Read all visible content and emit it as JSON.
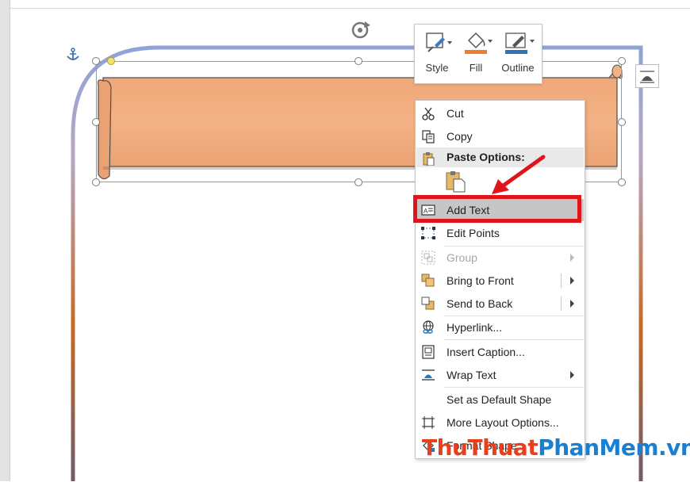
{
  "mini_toolbar": {
    "style_label": "Style",
    "fill_label": "Fill",
    "outline_label": "Outline",
    "colors": {
      "fill": "#ed7d31",
      "outline": "#2e75b6"
    }
  },
  "context_menu": {
    "cut": "Cut",
    "copy": "Copy",
    "paste_options_header": "Paste Options:",
    "add_text": "Add Text",
    "edit_points": "Edit Points",
    "group": "Group",
    "bring_to_front": "Bring to Front",
    "send_to_back": "Send to Back",
    "hyperlink": "Hyperlink...",
    "insert_caption": "Insert Caption...",
    "wrap_text": "Wrap Text",
    "set_default_shape": "Set as Default Shape",
    "more_layout_options": "More Layout Options...",
    "format_shape": "Format Shape..."
  },
  "watermark": {
    "part1": "ThuThuat",
    "part2": "PhanMem",
    "part3": ".vn",
    "colors": {
      "part1": "#e8401c",
      "part2": "#1a7fd0",
      "part3": "#1a7fd0"
    }
  },
  "colors": {
    "banner_fill": "#f3b286",
    "frame_top": "#8fa3d6",
    "frame_mid": "#c46a24",
    "frame_bottom": "#6f5b6c",
    "highlight": "#e0141b",
    "arrow": "#e0141b",
    "selected_item_bg": "#c6c6c6"
  },
  "icons": [
    "anchor-icon",
    "rotate-handle-icon",
    "layout-options-icon",
    "scissors-icon",
    "copy-icon",
    "clipboard-icon",
    "textbox-icon",
    "edit-points-icon",
    "group-icon",
    "bring-front-icon",
    "send-back-icon",
    "hyperlink-icon",
    "caption-icon",
    "wrap-text-icon",
    "layout-icon",
    "format-shape-icon"
  ]
}
